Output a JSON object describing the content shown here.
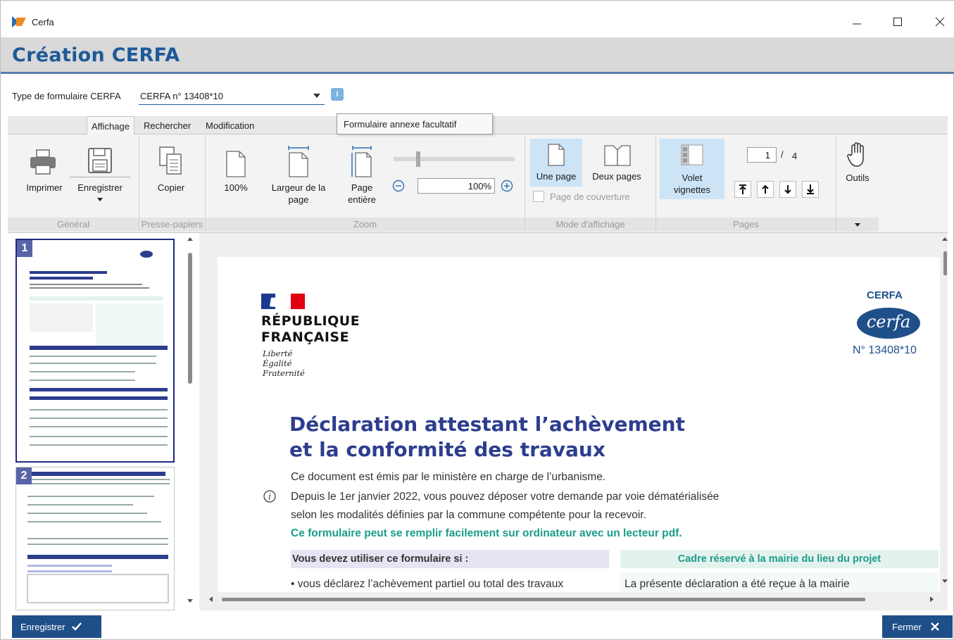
{
  "window": {
    "title": "Cerfa"
  },
  "header": {
    "title": "Création CERFA"
  },
  "form_type": {
    "label": "Type de formulaire CERFA",
    "value": "CERFA n° 13408*10",
    "info_glyph": "i"
  },
  "tooltip": {
    "text": "Formulaire annexe facultatif"
  },
  "ribbon": {
    "tabs": [
      {
        "label": "Affichage"
      },
      {
        "label": "Rechercher"
      },
      {
        "label": "Modification"
      }
    ],
    "buttons": {
      "print": "Imprimer",
      "save": "Enregistrer",
      "copy": "Copier",
      "zoom_100": "100%",
      "fit_width_1": "Largeur de la",
      "fit_width_2": "page",
      "fit_page_1": "Page",
      "fit_page_2": "entière",
      "zoom_value": "100%",
      "one_page": "Une page",
      "two_pages": "Deux pages",
      "cover_page": "Page de couverture",
      "thumbnails_1": "Volet",
      "thumbnails_2": "vignettes",
      "tools": "Outils"
    },
    "page_nav": {
      "current": "1",
      "separator": "/",
      "total": "4"
    },
    "groups": [
      {
        "label": "Général"
      },
      {
        "label": "Presse-papiers"
      },
      {
        "label": "Zoom"
      },
      {
        "label": "Mode d'affichage"
      },
      {
        "label": "Pages"
      }
    ]
  },
  "thumbnails": [
    {
      "number": "1"
    },
    {
      "number": "2"
    }
  ],
  "document": {
    "cerfa_label": "CERFA",
    "cerfa_logo_text": "cerfa",
    "cerfa_number": "N° 13408*10",
    "republic_1": "RÉPUBLIQUE",
    "republic_2": "FRANÇAISE",
    "motto_1": "Liberté",
    "motto_2": "Égalité",
    "motto_3": "Fraternité",
    "title_line1": "Déclaration attestant l’achèvement",
    "title_line2": "et la conformité des travaux",
    "intro": "Ce document est émis par le ministère en charge de l’urbanisme.",
    "info_line1": "Depuis le 1er janvier 2022, vous pouvez déposer votre demande par voie dématérialisée",
    "info_line2": "selon les modalités définies par la commune compétente pour la recevoir.",
    "highlight": "Ce formulaire peut se remplir facilement sur ordinateur avec un lecteur pdf.",
    "left_header": "Vous devez utiliser ce formulaire si :",
    "right_header": "Cadre réservé à la mairie du lieu du projet",
    "left_item": "• vous déclarez l’achèvement partiel ou total des travaux",
    "right_item": "La présente déclaration a été reçue à la mairie"
  },
  "footer": {
    "save": "Enregistrer",
    "close": "Fermer"
  },
  "colors": {
    "accent": "#1f5a99",
    "button": "#1f4f88",
    "green": "#1b9c8a",
    "title_blue": "#2d3d8e"
  }
}
